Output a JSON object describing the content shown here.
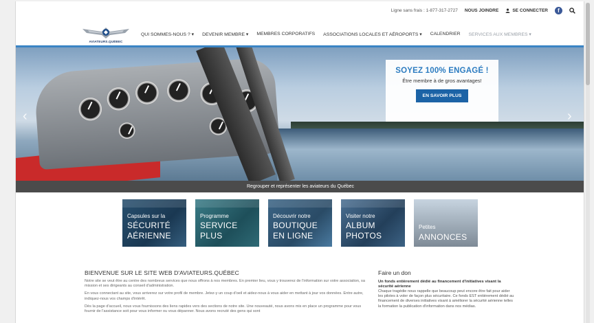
{
  "topbar": {
    "phone": "Ligne sans frais : 1-877-317-2727",
    "contact": "NOUS JOINDRE",
    "login": "SE CONNECTER",
    "facebook_icon": "facebook-icon",
    "search_icon": "search-icon"
  },
  "logo": {
    "text": "AVIATEURS.QUÉBEC"
  },
  "nav": {
    "items": [
      "QUI SOMMES-NOUS ? ▾",
      "DEVENIR MEMBRE ▾",
      "MEMBRES CORPORATIFS",
      "ASSOCIATIONS LOCALES ET AÉROPORTS ▾",
      "CALENDRIER",
      "SERVICES AUX MEMBRES ▾"
    ]
  },
  "hero": {
    "promo_title": "SOYEZ 100% ENGAGÉ !",
    "promo_subtitle": "Être membre à de gros avantages!",
    "promo_button": "EN SAVOIR PLUS",
    "caption": "Regrouper et représenter les aviateurs du Québec"
  },
  "tiles": [
    {
      "small": "Capsules sur la",
      "big1": "SÉCURITÉ",
      "big2": "AÉRIENNE"
    },
    {
      "small": "Programme",
      "big1": "SERVICE",
      "big2": "PLUS"
    },
    {
      "small": "Découvrir notre",
      "big1": "BOUTIQUE",
      "big2": "EN LIGNE"
    },
    {
      "small": "Visiter notre",
      "big1": "ALBUM",
      "big2": "PHOTOS"
    },
    {
      "small": "Petites",
      "big1": "ANNONCES",
      "big2": ""
    }
  ],
  "welcome": {
    "title": "BIENVENUE SUR LE SITE WEB D'AVIATEURS.QUÉBEC",
    "p1": "Notre site se veut être au centre des nombreux services que nous offrons à nos membres. En premier lieu, vous y trouverez de l'information sur votre association, sa mission et ses dirigeants au conseil d'administration.",
    "p2": "En vous connectant au site, vous arriverez sur votre profil de membre. Jetez-y un coup d'oeil et aidez-nous à vous aider en mettant à jour vos données. Entre autre, indiquez-nous vos champs d'intérêt.",
    "p3": "Dès la page d'accueil, nous vous fournissons des liens rapides vers des sections de notre site. Une nouveauté, nous avons mis en place un programme pour vous fournir de l'assistance soit pour vous informer ou vous dépanner. Nous avons recruté des gens qui sont"
  },
  "donate": {
    "title": "Faire un don",
    "subtitle": "Un fonds entièrement dédié au financement d'initiatives visant la sécurité aérienne",
    "body": "Chaque tragédie nous rappelle que beaucoup peut encore être fait pour aider les pilotes à voler de façon plus sécuritaire. Ce fonds EST entièrement dédié au financement de diverses initiatives visant à améliorer la sécurité aérienne telles la formation la publication d'information dans nos médias."
  }
}
